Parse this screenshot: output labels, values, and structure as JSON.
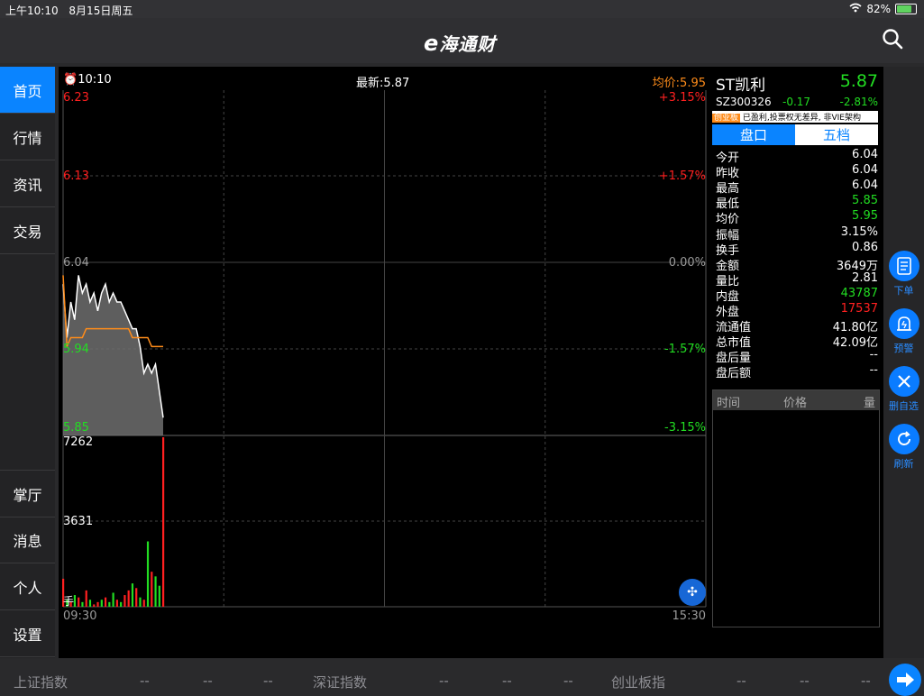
{
  "status": {
    "time": "上午10:10",
    "date": "8月15日周五",
    "battery": "82%",
    "battery_level": 0.82
  },
  "header": {
    "logo_e": "e",
    "logo_text": "海通财"
  },
  "sidebar": {
    "items": [
      {
        "label": "首页",
        "active": true
      },
      {
        "label": "行情"
      },
      {
        "label": "资讯"
      },
      {
        "label": "交易"
      },
      {
        "label": "掌厅"
      },
      {
        "label": "消息"
      },
      {
        "label": "个人"
      },
      {
        "label": "设置"
      }
    ]
  },
  "chart": {
    "time": "10:10",
    "latest": "最新:5.87",
    "avg": "均价:5.95",
    "price_labels": [
      "6.23",
      "6.13",
      "6.04",
      "5.94",
      "5.85"
    ],
    "pct_labels": [
      "+3.15%",
      "+1.57%",
      "0.00%",
      "-1.57%",
      "-3.15%"
    ],
    "vol_labels": [
      "7262",
      "3631"
    ],
    "vol_unit": "手",
    "time_start": "09:30",
    "time_end": "15:30"
  },
  "chart_data": {
    "type": "line",
    "x_label_start": "09:30",
    "x_label_end": "15:30",
    "ylim": [
      5.85,
      6.23
    ],
    "series": [
      {
        "values": [
          6.02,
          5.96,
          6.0,
          5.98,
          6.03,
          6.01,
          6.02,
          6.0,
          6.01,
          5.99,
          6.01,
          6.02,
          6.0,
          6.01,
          6.0,
          6.0,
          5.99,
          5.98,
          5.97,
          5.97,
          5.95,
          5.92,
          5.93,
          5.92,
          5.93,
          5.9,
          5.87
        ]
      },
      {
        "values": [
          6.03,
          5.95,
          5.96,
          5.96,
          5.96,
          5.96,
          5.97,
          5.97,
          5.97,
          5.97,
          5.97,
          5.97,
          5.97,
          5.97,
          5.97,
          5.97,
          5.97,
          5.97,
          5.96,
          5.96,
          5.96,
          5.96,
          5.96,
          5.95,
          5.95,
          5.95,
          5.95
        ]
      }
    ],
    "volume": [
      1200,
      300,
      200,
      500,
      400,
      200,
      700,
      300,
      100,
      200,
      300,
      400,
      200,
      600,
      300,
      200,
      500,
      700,
      1000,
      800,
      400,
      300,
      2800,
      1500,
      1300,
      900,
      7262
    ],
    "volume_up": [
      true,
      false,
      true,
      false,
      true,
      false,
      true,
      false,
      true,
      true,
      false,
      true,
      false,
      false,
      true,
      false,
      true,
      true,
      false,
      true,
      false,
      true,
      false,
      true,
      false,
      false,
      true
    ]
  },
  "stock": {
    "name": "ST凯利",
    "price": "5.87",
    "code": "SZ300326",
    "change": "-0.17",
    "change_pct": "-2.81%",
    "tag": "创业板",
    "note": "已盈利,投票权无差异, 非VIE架构",
    "tab_active": "盘口",
    "tab_other": "五档",
    "rows": [
      {
        "k": "今开",
        "v": "6.04",
        "c": "white"
      },
      {
        "k": "昨收",
        "v": "6.04",
        "c": "white"
      },
      {
        "k": "最高",
        "v": "6.04",
        "c": "white"
      },
      {
        "k": "最低",
        "v": "5.85",
        "c": "green"
      },
      {
        "k": "均价",
        "v": "5.95",
        "c": "green"
      },
      {
        "k": "振幅",
        "v": "3.15%",
        "c": "white"
      },
      {
        "k": "换手",
        "v": "0.86",
        "c": "white"
      },
      {
        "k": "金额",
        "v": "3649万",
        "c": "white"
      },
      {
        "k": "量比",
        "v": "2.81",
        "c": "white"
      },
      {
        "k": "内盘",
        "v": "43787",
        "c": "green"
      },
      {
        "k": "外盘",
        "v": "17537",
        "c": "red"
      },
      {
        "k": "流通值",
        "v": "41.80亿",
        "c": "white"
      },
      {
        "k": "总市值",
        "v": "42.09亿",
        "c": "white"
      },
      {
        "k": "盘后量",
        "v": "--",
        "c": "white"
      },
      {
        "k": "盘后额",
        "v": "--",
        "c": "white"
      }
    ],
    "trade_headers": [
      "时间",
      "价格",
      "量"
    ]
  },
  "right_buttons": [
    {
      "label": "下单",
      "icon": "order-icon"
    },
    {
      "label": "预警",
      "icon": "alarm-icon"
    },
    {
      "label": "删自选",
      "icon": "close-icon"
    },
    {
      "label": "刷新",
      "icon": "refresh-icon"
    }
  ],
  "bottom": {
    "sh": "上证指数",
    "sz": "深证指数",
    "cy": "创业板指",
    "dash": "--"
  },
  "colors": {
    "accent": "#0a84ff",
    "up": "#ff2020",
    "down": "#22dd22",
    "avg": "#ff8c1a"
  }
}
